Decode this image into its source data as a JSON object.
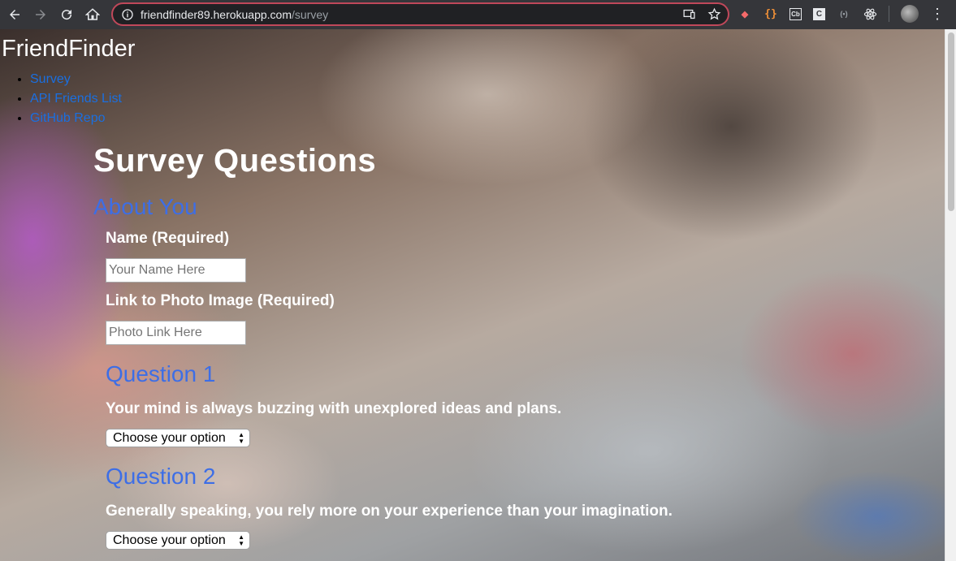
{
  "browser": {
    "url_host": "friendfinder89.herokuapp.com",
    "url_path": "/survey"
  },
  "site": {
    "brand": "FriendFinder",
    "nav_links": [
      "Survey",
      "API Friends List",
      "GitHub Repo"
    ]
  },
  "survey": {
    "title": "Survey Questions",
    "about_heading": "About You",
    "name_label": "Name (Required)",
    "name_placeholder": "Your Name Here",
    "photo_label": "Link to Photo Image (Required)",
    "photo_placeholder": "Photo Link Here",
    "questions": [
      {
        "heading": "Question 1",
        "text": "Your mind is always buzzing with unexplored ideas and plans.",
        "selected": "Choose your option"
      },
      {
        "heading": "Question 2",
        "text": "Generally speaking, you rely more on your experience than your imagination.",
        "selected": "Choose your option"
      }
    ]
  },
  "colors": {
    "link": "#1a6fe0",
    "section_heading": "#3d6ee6",
    "omnibox_border": "#c0485a"
  }
}
